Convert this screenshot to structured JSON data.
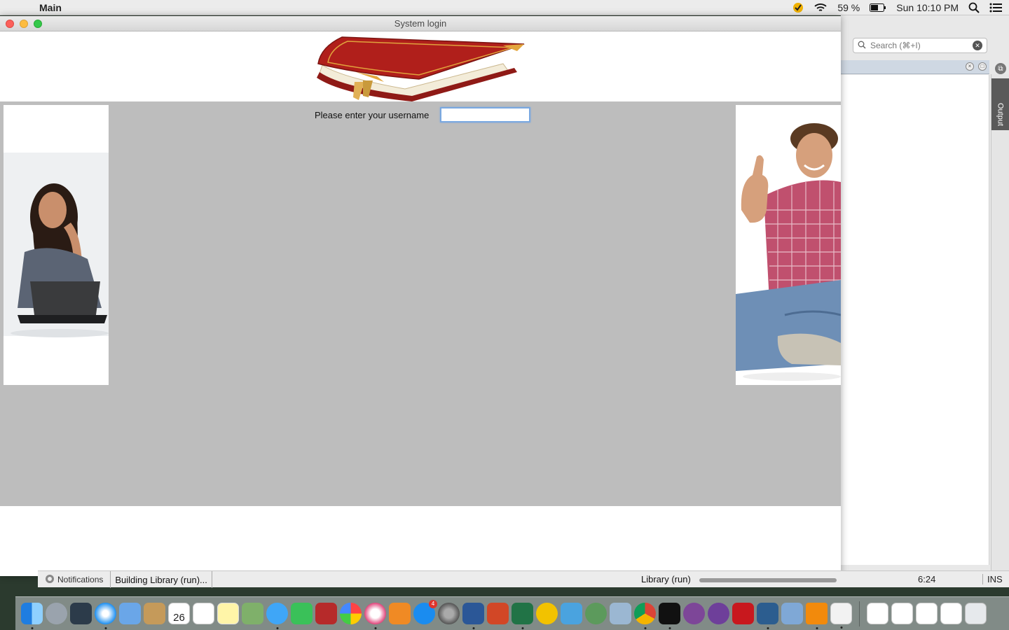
{
  "menubar": {
    "app_name": "Main",
    "battery": "59 %",
    "clock": "Sun 10:10 PM"
  },
  "ide": {
    "search_placeholder": "Search (⌘+I)",
    "output_tab": "Output"
  },
  "window": {
    "title": "System login"
  },
  "login": {
    "prompt": "Please enter your username",
    "username_value": ""
  },
  "status": {
    "notifications_label": "Notifications",
    "building_label": "Building Library (run)...",
    "task_label": "Library (run)",
    "cursor_position": "6:24",
    "insert_mode": "INS"
  },
  "dock": {
    "calendar_day": "26",
    "appstore_badge": "4"
  }
}
